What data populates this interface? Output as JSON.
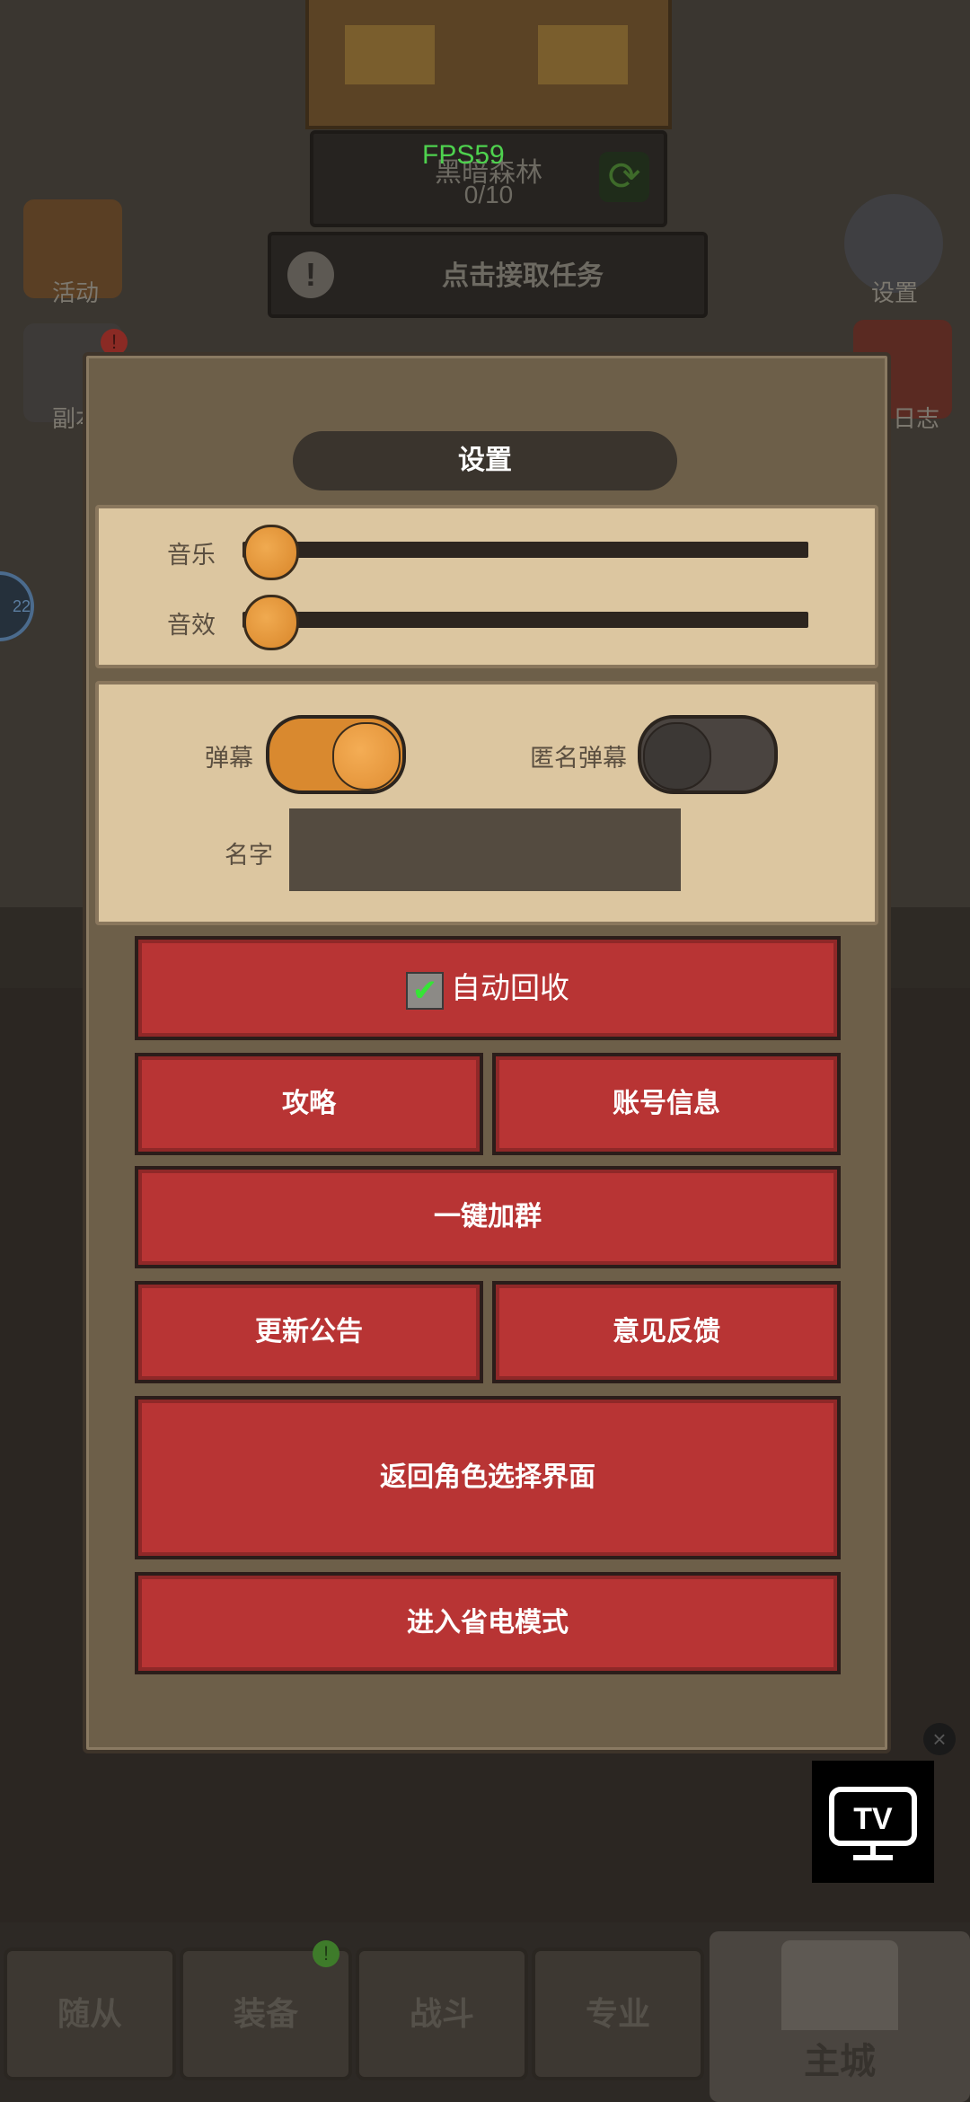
{
  "background": {
    "fps": "FPS59",
    "map_name": "黑暗森林",
    "map_count": "0/10",
    "quest_text": "点击接取任务",
    "side_left": [
      "活动",
      "副本"
    ],
    "side_right": [
      "设置",
      "日志"
    ],
    "ring_value": "22",
    "bottom_nav": [
      "随从",
      "装备",
      "战斗",
      "专业",
      "主城"
    ]
  },
  "modal": {
    "title": "设置",
    "audio": {
      "music_label": "音乐",
      "music_level": 0,
      "sfx_label": "音效",
      "sfx_level": 0
    },
    "options": {
      "barrage_label": "弹幕",
      "barrage_on": true,
      "anon_barrage_label": "匿名弹幕",
      "anon_barrage_on": false,
      "name_label": "名字",
      "name_value": ""
    },
    "buttons": {
      "auto_recycle": "自动回收",
      "auto_recycle_checked": true,
      "guide": "攻略",
      "account_info": "账号信息",
      "join_group": "一键加群",
      "update_notice": "更新公告",
      "feedback": "意见反馈",
      "back_to_character": "返回角色选择界面",
      "power_saving": "进入省电模式"
    }
  },
  "overlay": {
    "tv_label": "TV"
  }
}
